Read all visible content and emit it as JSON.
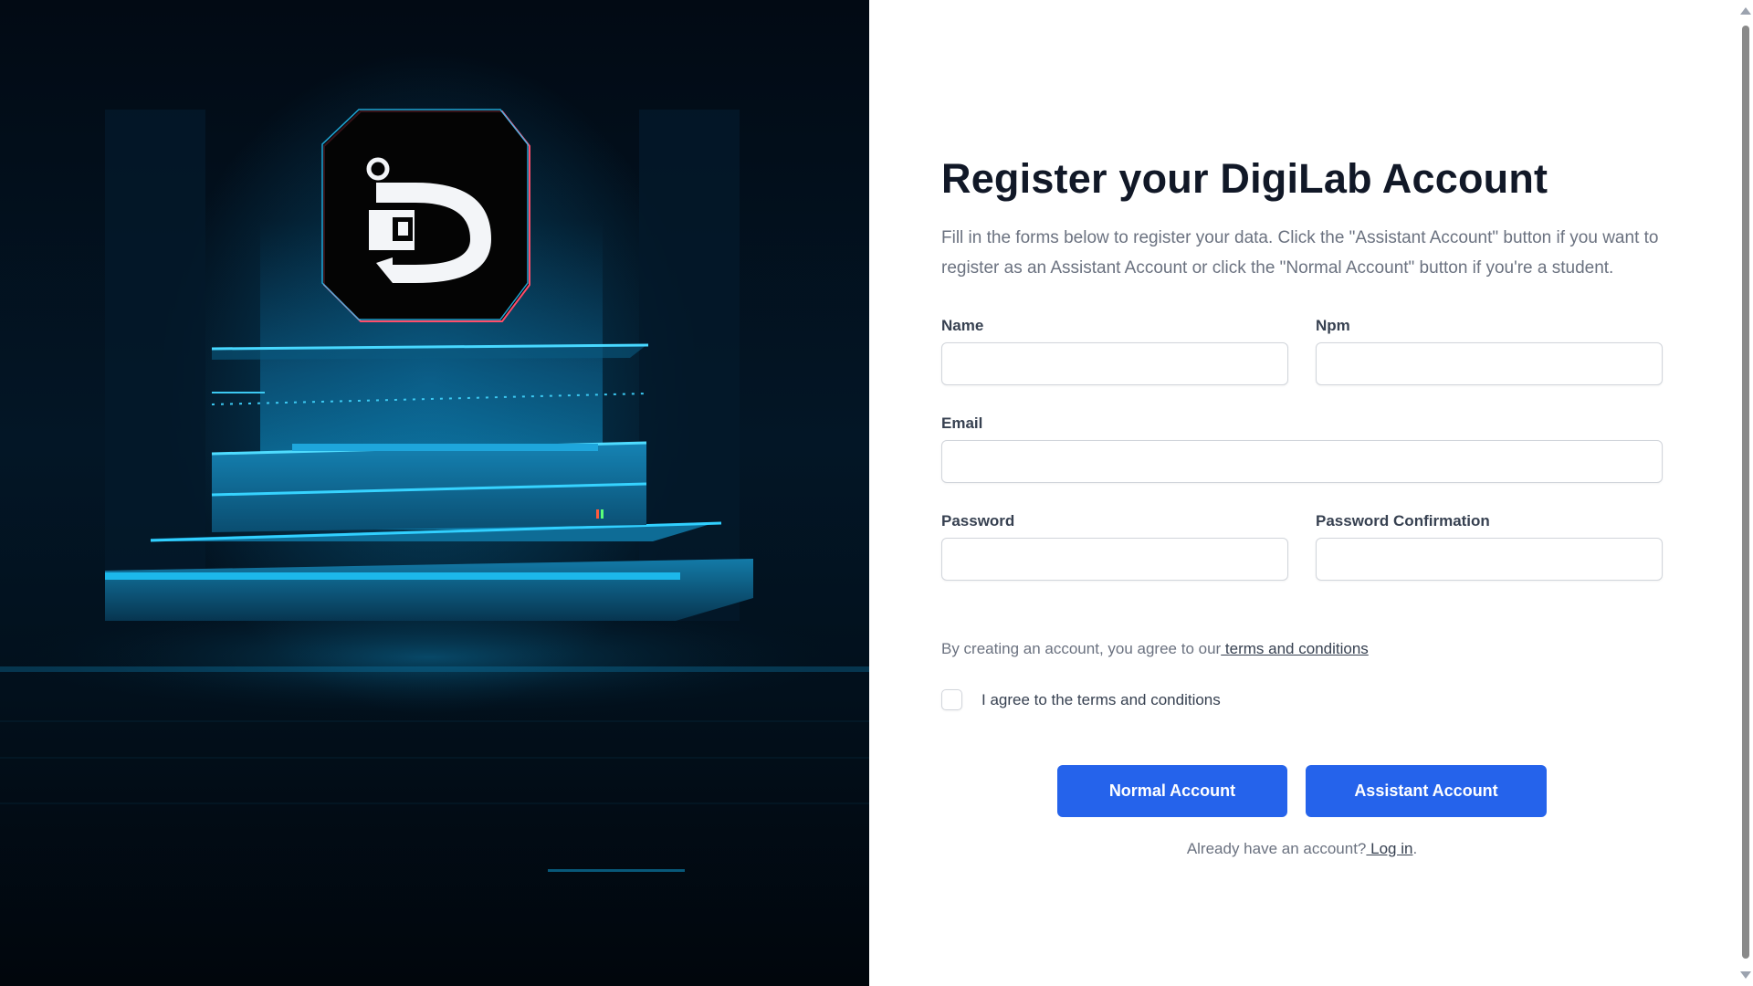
{
  "brand": {
    "logo_icon": "digilab-d-logo-icon"
  },
  "form": {
    "title": "Register your DigiLab Account",
    "intro": "Fill in the forms below to register your data. Click the \"Assistant Account\" button if you want to register as an Assistant Account or click the \"Normal Account\" button if you're a student.",
    "fields": {
      "name": {
        "label": "Name",
        "value": "",
        "placeholder": ""
      },
      "npm": {
        "label": "Npm",
        "value": "",
        "placeholder": ""
      },
      "email": {
        "label": "Email",
        "value": "",
        "placeholder": ""
      },
      "password": {
        "label": "Password",
        "value": "",
        "placeholder": ""
      },
      "password_confirmation": {
        "label": "Password Confirmation",
        "value": "",
        "placeholder": ""
      }
    },
    "terms": {
      "prefix": "By creating an account, you agree to our",
      "link": " terms and conditions"
    },
    "agree_label": "I agree to the terms and conditions",
    "agree_checked": false,
    "buttons": {
      "normal": "Normal Account",
      "assistant": "Assistant Account"
    },
    "login": {
      "prefix": "Already have an account?",
      "link": " Log in",
      "suffix": "."
    }
  },
  "colors": {
    "primary": "#2563eb",
    "heading": "#111827",
    "muted": "#6b7280",
    "hero_glow": "#0aa6e8"
  }
}
